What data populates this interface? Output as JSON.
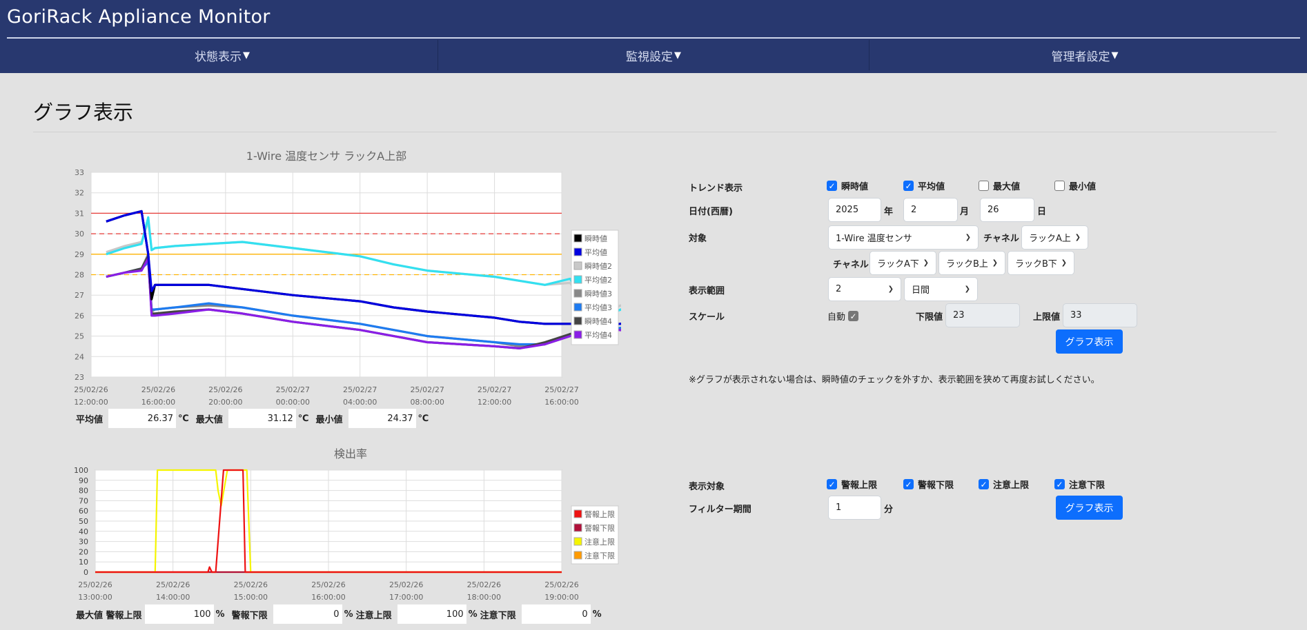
{
  "app": {
    "title": "GoriRack Appliance Monitor"
  },
  "nav": [
    {
      "label": "状態表示"
    },
    {
      "label": "監視設定"
    },
    {
      "label": "管理者設定"
    }
  ],
  "page": {
    "title": "グラフ表示"
  },
  "colors": {
    "header_bg": "#28386f",
    "accent": "#0d6efd",
    "page_bg": "#e2e2e2"
  },
  "temp_stats": {
    "avg_label": "平均値",
    "avg_value": "26.37",
    "avg_unit": "℃",
    "max_label": "最大値",
    "max_value": "31.12",
    "max_unit": "℃",
    "min_label": "最小値",
    "min_value": "24.37",
    "min_unit": "℃"
  },
  "detect_stats": {
    "label1": "最大値 警報上限",
    "value1": "100",
    "unit1": "%",
    "label2": "警報下限",
    "value2": "0",
    "unit2": "%",
    "label3": "注意上限",
    "value3": "100",
    "unit3": "%",
    "label4": "注意下限",
    "value4": "0",
    "unit4": "%"
  },
  "form": {
    "trend_label": "トレンド表示",
    "trend_options": [
      {
        "label": "瞬時値",
        "checked": true
      },
      {
        "label": "平均値",
        "checked": true
      },
      {
        "label": "最大値",
        "checked": false
      },
      {
        "label": "最小値",
        "checked": false
      }
    ],
    "date_label": "日付(西暦)",
    "year": "2025",
    "year_unit": "年",
    "month": "2",
    "month_unit": "月",
    "day": "26",
    "day_unit": "日",
    "target_label": "対象",
    "target_value": "1-Wire 温度センサ",
    "channel_label": "チャネル",
    "channel_value": "ラックA上",
    "channel2_label": "チャネル",
    "channel2_values": [
      "ラックA下",
      "ラックB上",
      "ラックB下"
    ],
    "range_label": "表示範囲",
    "range_value": "2",
    "range_unit": "日間",
    "scale_label": "スケール",
    "auto_label": "自動",
    "auto_checked": true,
    "lower_label": "下限値",
    "lower_value": "23",
    "upper_label": "上限値",
    "upper_value": "33",
    "graph_button": "グラフ表示",
    "note": "※グラフが表示されない場合は、瞬時値のチェックを外すか、表示範囲を狭めて再度お試しください。",
    "display_target_label": "表示対象",
    "display_options": [
      {
        "label": "警報上限",
        "checked": true
      },
      {
        "label": "警報下限",
        "checked": true
      },
      {
        "label": "注意上限",
        "checked": true
      },
      {
        "label": "注意下限",
        "checked": true
      }
    ],
    "filter_label": "フィルター期間",
    "filter_value": "1",
    "filter_unit": "分",
    "graph_button2": "グラフ表示"
  },
  "chart_data": [
    {
      "type": "line",
      "title": "1-Wire 温度センサ ラックA上部",
      "xlabel": "",
      "ylabel": "",
      "ylim": [
        23,
        33
      ],
      "xlim": [
        "2025-02-26T12:00",
        "2025-02-27T16:00"
      ],
      "y_ticks": [
        23,
        24,
        25,
        26,
        27,
        28,
        29,
        30,
        31,
        32,
        33
      ],
      "x_ticks": [
        {
          "date": "25/02/26",
          "time": "12:00:00"
        },
        {
          "date": "25/02/26",
          "time": "16:00:00"
        },
        {
          "date": "25/02/26",
          "time": "20:00:00"
        },
        {
          "date": "25/02/27",
          "time": "00:00:00"
        },
        {
          "date": "25/02/27",
          "time": "04:00:00"
        },
        {
          "date": "25/02/27",
          "time": "08:00:00"
        },
        {
          "date": "25/02/27",
          "time": "12:00:00"
        },
        {
          "date": "25/02/27",
          "time": "16:00:00"
        }
      ],
      "grid": true,
      "legend_position": "right",
      "thresholds": [
        {
          "value": 31,
          "color": "#e53935",
          "style": "solid"
        },
        {
          "value": 30,
          "color": "#e53935",
          "style": "dashed"
        },
        {
          "value": 29,
          "color": "#ffb300",
          "style": "solid"
        },
        {
          "value": 28,
          "color": "#ffb300",
          "style": "dashed"
        }
      ],
      "x_hours": [
        0.9,
        2.0,
        3.0,
        3.4,
        3.6,
        3.8,
        5.0,
        7.0,
        9.0,
        12.0,
        16.0,
        18.0,
        20.0,
        24.0,
        25.5,
        27.0,
        28.5,
        30.0,
        31.5,
        33.0,
        34.0
      ],
      "series": [
        {
          "name": "瞬時値",
          "color": "#000000",
          "values": [
            30.6,
            30.9,
            31.1,
            29.0,
            26.8,
            27.5,
            27.5,
            27.5,
            27.3,
            27.0,
            26.7,
            26.4,
            26.2,
            25.9,
            25.7,
            25.6,
            25.6,
            25.5,
            25.6,
            25.7,
            26.1
          ]
        },
        {
          "name": "平均値",
          "color": "#0000e0",
          "values": [
            30.6,
            30.9,
            31.1,
            29.0,
            27.2,
            27.5,
            27.5,
            27.5,
            27.3,
            27.0,
            26.7,
            26.4,
            26.2,
            25.9,
            25.7,
            25.6,
            25.6,
            25.5,
            25.6,
            25.7,
            26.0
          ]
        },
        {
          "name": "瞬時値2",
          "color": "#c8c8c8",
          "values": [
            29.1,
            29.4,
            29.6,
            30.6,
            29.2,
            29.3,
            29.4,
            29.5,
            29.6,
            29.3,
            28.9,
            28.5,
            28.2,
            27.9,
            27.7,
            27.5,
            27.6,
            25.9,
            26.5,
            25.6,
            25.7
          ]
        },
        {
          "name": "平均値2",
          "color": "#33e0f0",
          "values": [
            29.0,
            29.3,
            29.5,
            30.8,
            29.2,
            29.3,
            29.4,
            29.5,
            29.6,
            29.3,
            28.9,
            28.5,
            28.2,
            27.9,
            27.7,
            27.5,
            27.8,
            25.7,
            26.3,
            25.5,
            26.0
          ]
        },
        {
          "name": "瞬時値3",
          "color": "#888888",
          "values": [
            27.9,
            28.1,
            28.3,
            29.0,
            26.2,
            26.3,
            26.4,
            26.5,
            26.4,
            26.0,
            25.6,
            25.3,
            25.0,
            24.7,
            24.5,
            24.6,
            25.0,
            25.2,
            25.4,
            25.2,
            24.8
          ]
        },
        {
          "name": "平均値3",
          "color": "#1e7bf0",
          "values": [
            27.9,
            28.1,
            28.3,
            28.6,
            26.3,
            26.3,
            26.4,
            26.6,
            26.4,
            26.0,
            25.6,
            25.3,
            25.0,
            24.7,
            24.6,
            24.6,
            25.1,
            25.3,
            25.4,
            25.1,
            24.8
          ]
        },
        {
          "name": "瞬時値4",
          "color": "#444444",
          "values": [
            27.9,
            28.1,
            28.3,
            28.9,
            26.1,
            26.1,
            26.2,
            26.3,
            26.1,
            25.7,
            25.3,
            25.0,
            24.7,
            24.5,
            24.4,
            24.7,
            25.1,
            25.3,
            25.3,
            24.8,
            24.9
          ]
        },
        {
          "name": "平均値4",
          "color": "#8a1ee6",
          "values": [
            27.9,
            28.1,
            28.2,
            28.8,
            26.0,
            26.0,
            26.1,
            26.3,
            26.1,
            25.7,
            25.3,
            25.0,
            24.7,
            24.5,
            24.4,
            24.6,
            25.0,
            25.2,
            25.3,
            24.7,
            24.8
          ]
        }
      ]
    },
    {
      "type": "line",
      "title": "検出率",
      "xlabel": "",
      "ylabel": "",
      "ylim": [
        0,
        100
      ],
      "y_ticks": [
        0,
        10,
        20,
        30,
        40,
        50,
        60,
        70,
        80,
        90,
        100
      ],
      "x_ticks": [
        {
          "date": "25/02/26",
          "time": "13:00:00"
        },
        {
          "date": "25/02/26",
          "time": "14:00:00"
        },
        {
          "date": "25/02/26",
          "time": "15:00:00"
        },
        {
          "date": "25/02/26",
          "time": "16:00:00"
        },
        {
          "date": "25/02/26",
          "time": "17:00:00"
        },
        {
          "date": "25/02/26",
          "time": "18:00:00"
        },
        {
          "date": "25/02/26",
          "time": "19:00:00"
        }
      ],
      "grid": true,
      "legend_position": "right",
      "series": [
        {
          "name": "警報上限",
          "color": "#ee1111",
          "x": [
            0,
            1.45,
            1.47,
            1.5,
            1.55,
            1.65,
            1.9,
            1.93,
            1.97,
            6
          ],
          "values": [
            0,
            0,
            5,
            0,
            0,
            100,
            100,
            0,
            0,
            0
          ]
        },
        {
          "name": "警報下限",
          "color": "#b0103a",
          "x": [
            0,
            6
          ],
          "values": [
            0,
            0
          ]
        },
        {
          "name": "注意上限",
          "color": "#f5f500",
          "x": [
            0,
            0.77,
            0.8,
            1.55,
            1.58,
            1.62,
            1.7,
            1.9,
            1.95,
            2.0,
            6
          ],
          "values": [
            0,
            0,
            100,
            100,
            80,
            65,
            100,
            100,
            100,
            0,
            0
          ]
        },
        {
          "name": "注意下限",
          "color": "#ff9a00",
          "x": [
            0,
            6
          ],
          "values": [
            0,
            0
          ]
        }
      ]
    }
  ]
}
